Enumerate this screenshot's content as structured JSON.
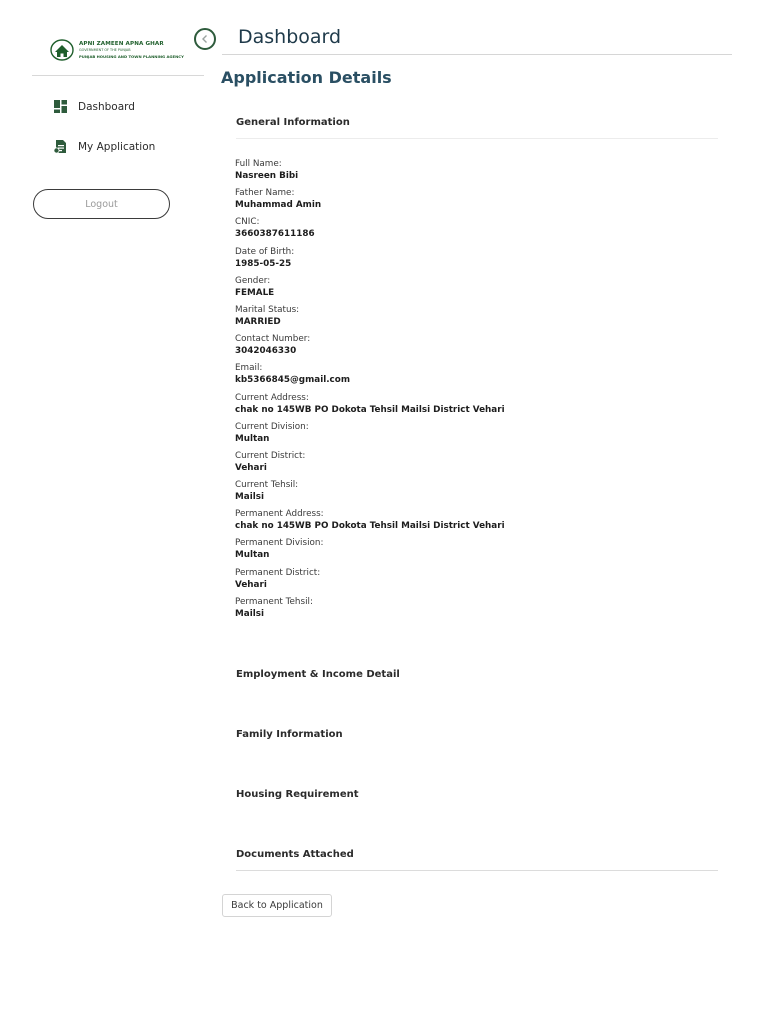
{
  "sidebar": {
    "logo": {
      "line1": "APNI ZAMEEN APNA GHAR",
      "line2": "GOVERNMENT OF THE PUNJAB",
      "line3": "PUNJAB HOUSING AND TOWN PLANNING AGENCY"
    },
    "items": [
      {
        "label": "Dashboard",
        "icon": "dashboard-grid-icon"
      },
      {
        "label": "My Application",
        "icon": "document-icon"
      }
    ],
    "logout_label": "Logout",
    "collapse_icon": "chevron-left-icon"
  },
  "header": {
    "title": "Dashboard"
  },
  "main": {
    "section_title": "Application Details",
    "general_info": {
      "heading": "General Information",
      "fields": [
        {
          "label": "Full Name:",
          "value": "Nasreen Bibi"
        },
        {
          "label": "Father Name:",
          "value": "Muhammad Amin"
        },
        {
          "label": "CNIC:",
          "value": "3660387611186"
        },
        {
          "label": "Date of Birth:",
          "value": "1985-05-25"
        },
        {
          "label": "Gender:",
          "value": "FEMALE"
        },
        {
          "label": "Marital Status:",
          "value": "MARRIED"
        },
        {
          "label": "Contact Number:",
          "value": "3042046330"
        },
        {
          "label": "Email:",
          "value": "kb5366845@gmail.com"
        },
        {
          "label": "Current Address:",
          "value": "chak no 145WB PO Dokota Tehsil Mailsi District Vehari"
        },
        {
          "label": "Current Division:",
          "value": "Multan"
        },
        {
          "label": "Current District:",
          "value": "Vehari"
        },
        {
          "label": "Current Tehsil:",
          "value": "Mailsi"
        },
        {
          "label": "Permanent Address:",
          "value": "chak no 145WB PO Dokota Tehsil Mailsi District Vehari"
        },
        {
          "label": "Permanent Division:",
          "value": "Multan"
        },
        {
          "label": "Permanent District:",
          "value": "Vehari"
        },
        {
          "label": "Permanent Tehsil:",
          "value": "Mailsi"
        }
      ]
    },
    "employment_heading": "Employment & Income Detail",
    "family_heading": "Family Information",
    "housing_heading": "Housing Requirement",
    "documents_heading": "Documents Attached",
    "back_label": "Back to Application"
  },
  "colors": {
    "brand_green": "#1f5f2c",
    "title_blue": "#1f3a4a",
    "section_blue": "#2a4f63"
  }
}
